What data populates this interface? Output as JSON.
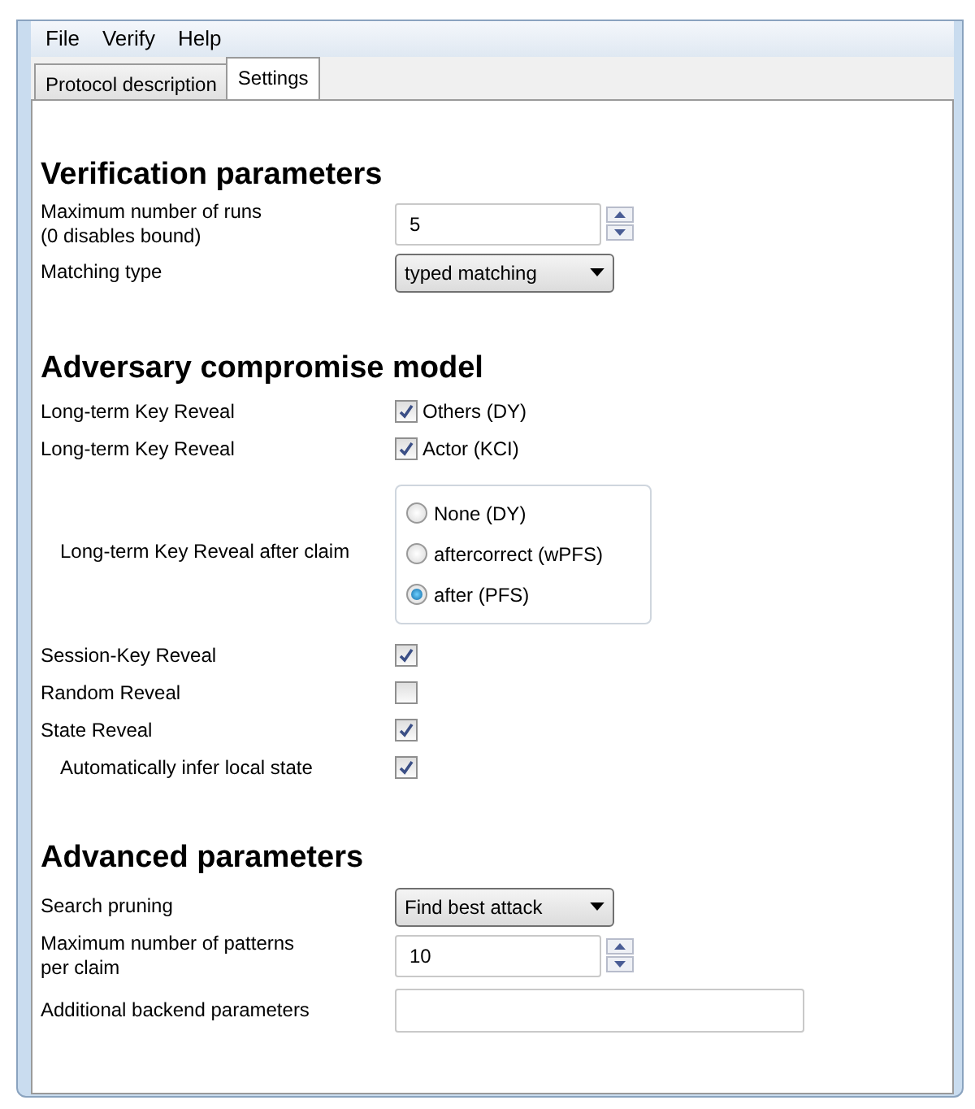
{
  "menu": [
    "File",
    "Verify",
    "Help"
  ],
  "tabs": [
    {
      "label": "Protocol description",
      "selected": false
    },
    {
      "label": "Settings",
      "selected": true
    }
  ],
  "sections": [
    {
      "title": "Verification parameters",
      "rows": [
        {
          "kind": "spin",
          "label": "Maximum number of runs\n(0 disables bound)",
          "value": "5"
        },
        {
          "kind": "select",
          "label": "Matching type",
          "value": "typed matching"
        }
      ]
    },
    {
      "title": "Adversary compromise model",
      "rows": [
        {
          "kind": "check",
          "label": "Long-term Key Reveal",
          "checked": true,
          "text": "Others (DY)"
        },
        {
          "kind": "check",
          "label": "Long-term Key Reveal",
          "checked": true,
          "text": "Actor (KCI)"
        },
        {
          "kind": "radio",
          "label": "Long-term Key Reveal after claim",
          "options": [
            {
              "label": "None (DY)",
              "selected": false
            },
            {
              "label": "aftercorrect (wPFS)",
              "selected": false
            },
            {
              "label": "after (PFS)",
              "selected": true
            }
          ]
        },
        {
          "kind": "check",
          "label": "Session-Key Reveal",
          "checked": true
        },
        {
          "kind": "check",
          "label": "Random Reveal",
          "checked": false
        },
        {
          "kind": "check",
          "label": "State Reveal",
          "checked": true,
          "children": [
            {
              "kind": "check",
              "label": "Automatically infer local state",
              "checked": true
            }
          ]
        }
      ]
    },
    {
      "title": "Advanced parameters",
      "rows": [
        {
          "kind": "select",
          "label": "Search pruning",
          "value": "Find best attack"
        },
        {
          "kind": "spin",
          "label": "Maximum number of patterns\nper claim",
          "value": "10"
        },
        {
          "kind": "text",
          "label": "Additional backend parameters"
        }
      ]
    }
  ]
}
